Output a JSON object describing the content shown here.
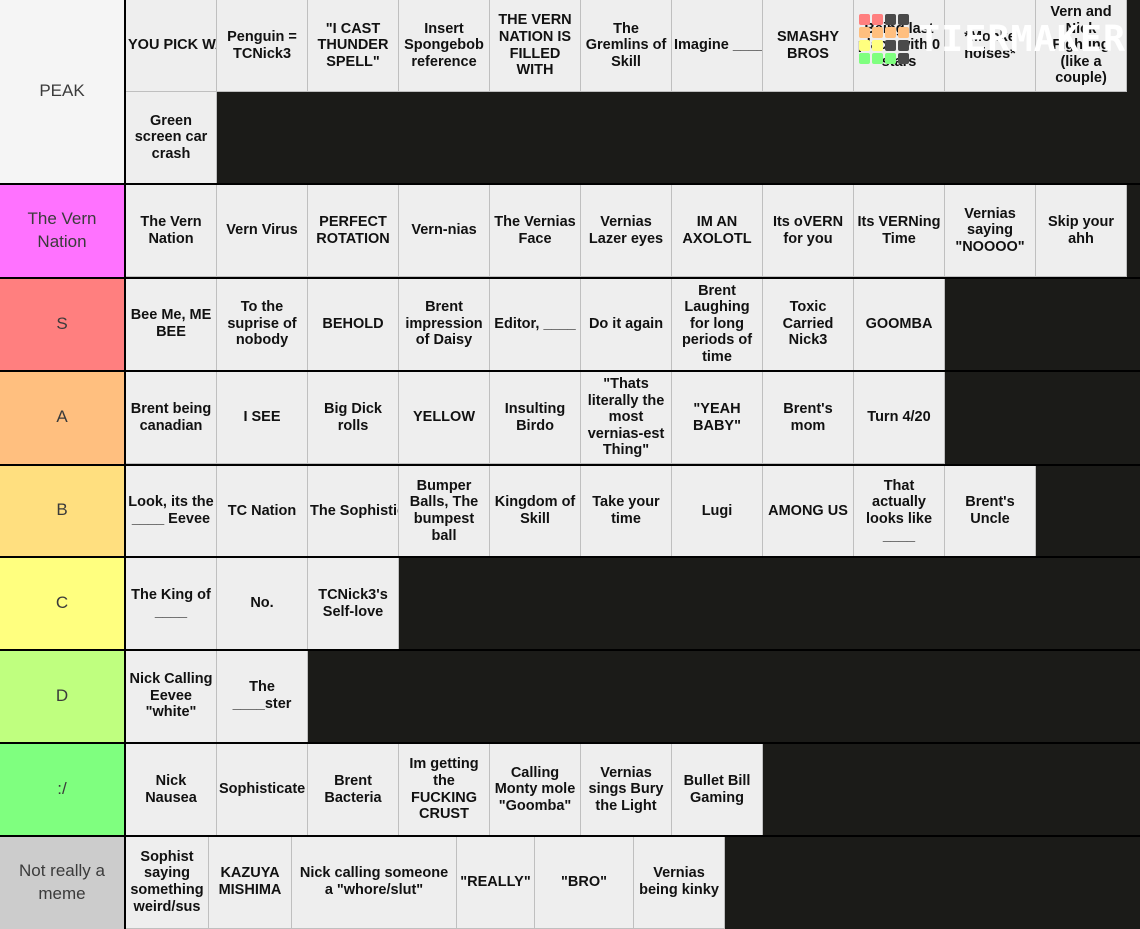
{
  "brand": {
    "name": "TIERMAKER",
    "logo_icon": "tiermaker-grid-icon",
    "logo_colors": [
      "#ff7f7f",
      "#ff7f7f",
      "#4a4a4a",
      "#4a4a4a",
      "#ffbf7f",
      "#ffbf7f",
      "#ffbf7f",
      "#ffbf7f",
      "#ffff7f",
      "#ffff7f",
      "#4a4a4a",
      "#4a4a4a",
      "#7fff7f",
      "#7fff7f",
      "#7fff7f",
      "#4a4a4a"
    ]
  },
  "tiers": [
    {
      "label": "PEAK",
      "color": "#f5f5f5",
      "items": [
        "YOU PICK WAAAAAAAA",
        "Penguin = TCNick3",
        "\"I CAST THUNDER SPELL\"",
        "Insert Spongebob reference",
        "THE VERN NATION IS FILLED WITH",
        "The Gremlins of Skill",
        "Imagine ____, Thats embarrassing",
        "SMASHY BROS",
        "Being last place with 0 stars",
        "*Monke noises*",
        "Vern and Nick Fighting (like a couple)",
        "Green screen car crash"
      ]
    },
    {
      "label": "The Vern Nation",
      "color": "#ff72ff",
      "items": [
        "The Vern Nation",
        "Vern Virus",
        "PERFECT ROTATION",
        "Vern-nias",
        "The Vernias Face",
        "Vernias Lazer eyes",
        "IM AN AXOLOTL",
        "Its oVERN for you",
        "Its VERNing Time",
        "Vernias saying \"NOOOO\"",
        "Skip your ahh"
      ]
    },
    {
      "label": "S",
      "color": "#ff7f7f",
      "items": [
        "Bee Me, ME BEE",
        "To the suprise of nobody",
        "BEHOLD",
        "Brent impression of Daisy",
        "Editor, ____",
        "Do it again",
        "Brent Laughing for long periods of time",
        "Toxic Carried Nick3",
        "GOOMBA"
      ]
    },
    {
      "label": "A",
      "color": "#ffbf7f",
      "items": [
        "Brent being canadian",
        "I SEE",
        "Big Dick rolls",
        "YELLOW",
        "Insulting Birdo",
        "\"Thats literally the most vernias-est Thing\"",
        "\"YEAH BABY\"",
        "Brent's mom",
        "Turn 4/20"
      ]
    },
    {
      "label": "B",
      "color": "#ffdf7f",
      "items": [
        "Look, its the ____ Eevee",
        "TC Nation",
        "The Sophisticate society",
        "Bumper Balls, The bumpest ball",
        "Kingdom of Skill",
        "Take your time",
        "Lugi",
        "AMONG US",
        "That actually looks like ____",
        "Brent's Uncle"
      ]
    },
    {
      "label": "C",
      "color": "#ffff7f",
      "items": [
        "The King of ____",
        "No.",
        "TCNick3's Self-love"
      ]
    },
    {
      "label": "D",
      "color": "#bfff7f",
      "items": [
        "Nick Calling Eevee \"white\"",
        "The ____ster"
      ]
    },
    {
      "label": ":/",
      "color": "#7fff7f",
      "items": [
        "Nick Nausea",
        "Sophisticate Sickness",
        "Brent Bacteria",
        "Im getting the FUCKING CRUST",
        "Calling Monty mole \"Goomba\"",
        "Vernias sings Bury the Light",
        "Bullet Bill Gaming"
      ]
    },
    {
      "label": "Not really a meme",
      "color": "#cccccc",
      "items": [
        "Sophist saying something weird/sus",
        "KAZUYA MISHIMA",
        "Nick calling someone a \"whore/slut\"",
        "\"REALLY\"",
        "\"BRO\"",
        "Vernias being kinky"
      ]
    }
  ]
}
